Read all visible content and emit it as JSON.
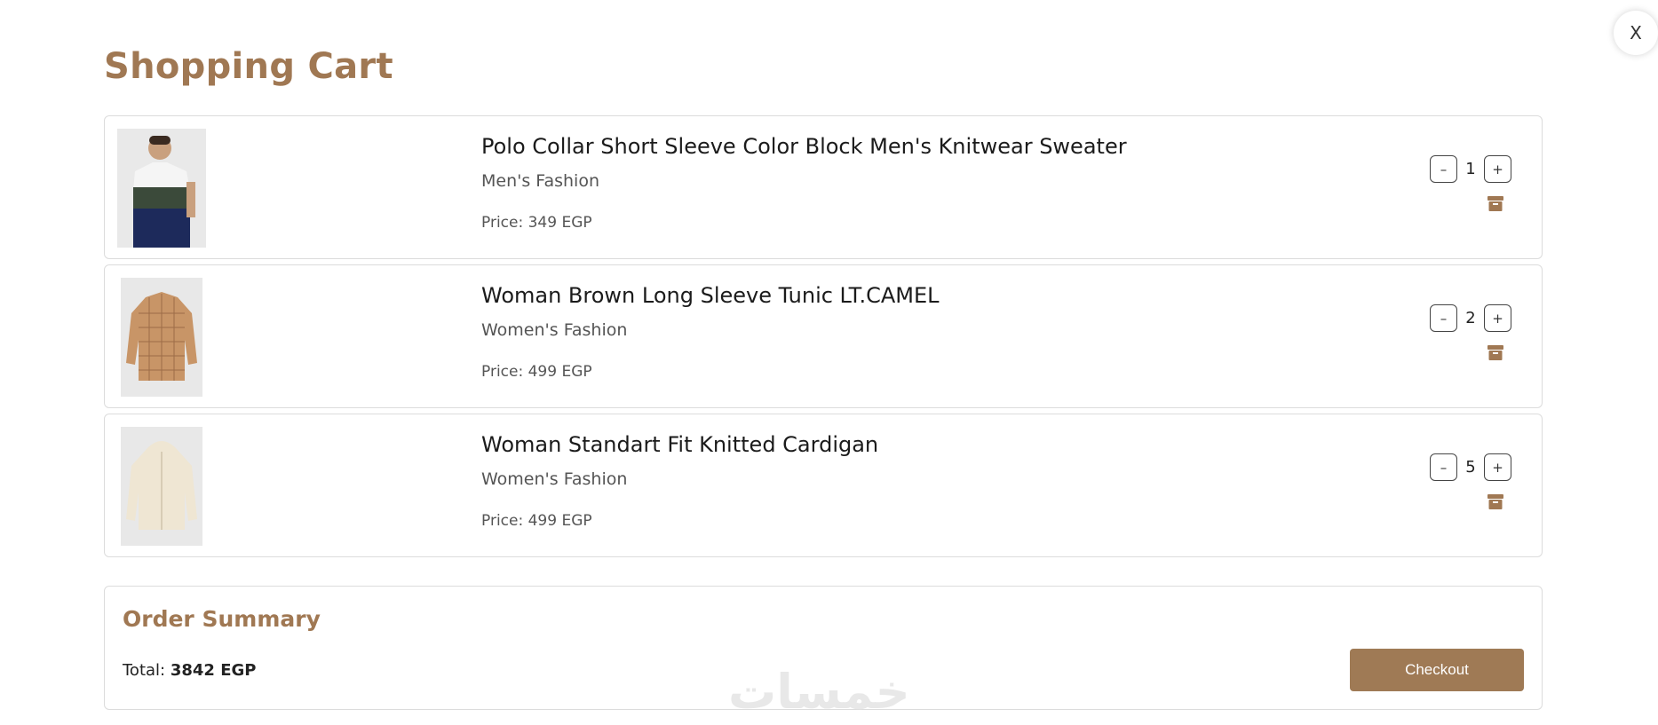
{
  "header": {
    "title": "Shopping Cart",
    "close_label": "X"
  },
  "cart": {
    "items": [
      {
        "name": "Polo Collar Short Sleeve Color Block Men's Knitwear Sweater",
        "category": "Men's Fashion",
        "price": "Price: 349 EGP",
        "quantity": "1",
        "decrement": "–",
        "increment": "+"
      },
      {
        "name": "Woman Brown Long Sleeve Tunic LT.CAMEL",
        "category": "Women's Fashion",
        "price": "Price: 499 EGP",
        "quantity": "2",
        "decrement": "–",
        "increment": "+"
      },
      {
        "name": "Woman Standart Fit Knitted Cardigan",
        "category": "Women's Fashion",
        "price": "Price: 499 EGP",
        "quantity": "5",
        "decrement": "–",
        "increment": "+"
      }
    ]
  },
  "summary": {
    "title": "Order Summary",
    "total_label": "Total:",
    "total_value": "3842 EGP",
    "checkout_label": "Checkout"
  },
  "watermark": {
    "text": "خمسات"
  },
  "colors": {
    "accent": "#a07853",
    "button": "#9f7a55",
    "border": "#dcdcdc"
  },
  "icons": {
    "delete": "archive-trash-icon"
  }
}
